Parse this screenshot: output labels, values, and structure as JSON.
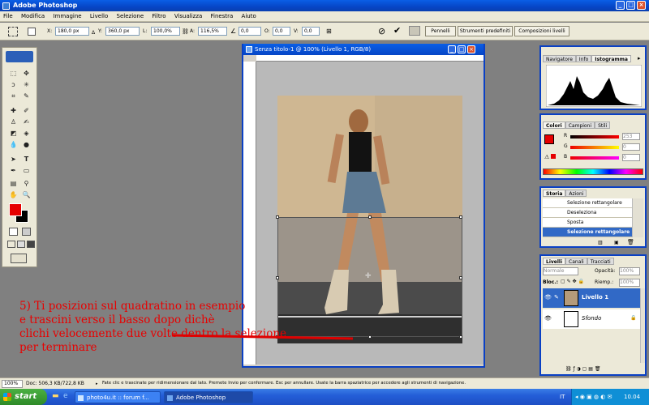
{
  "app": {
    "title": "Adobe Photoshop"
  },
  "menu": [
    "File",
    "Modifica",
    "Immagine",
    "Livello",
    "Selezione",
    "Filtro",
    "Visualizza",
    "Finestra",
    "Aiuto"
  ],
  "options": {
    "x_label": "X:",
    "x_value": "180,0 px",
    "y_label": "Y:",
    "y_value": "360,0 px",
    "w_label": "L:",
    "w_value": "100,0%",
    "h_label": "A:",
    "h_value": "116,5%",
    "angle_value": "0,0",
    "o_label": "O:",
    "o_value": "0,0",
    "v_label": "V:",
    "v_value": "0,0",
    "tabs": [
      "Pennelli",
      "Strumenti predefiniti",
      "Composizioni livelli"
    ]
  },
  "document": {
    "title": "Senza titolo-1 @ 100% (Livello 1, RGB/8)"
  },
  "navigator_panel": {
    "tabs": [
      "Navigatore",
      "Info",
      "Istogramma"
    ],
    "active_tab": "Istogramma"
  },
  "color_panel": {
    "tabs": [
      "Colori",
      "Campioni",
      "Stili"
    ],
    "r_label": "R",
    "g_label": "G",
    "b_label": "B",
    "r_value": "253",
    "g_value": "0",
    "b_value": "0"
  },
  "history_panel": {
    "tabs": [
      "Storia",
      "Azioni"
    ],
    "items": [
      "Selezione rettangolare",
      "Deseleziona",
      "Sposta",
      "Selezione rettangolare"
    ],
    "selected_index": 3
  },
  "layers_panel": {
    "tabs": [
      "Livelli",
      "Canali",
      "Tracciati"
    ],
    "blend_mode": "Normale",
    "opacity_label": "Opacità:",
    "opacity_value": "100%",
    "lock_label": "Bloc.:",
    "fill_label": "Riemp.:",
    "fill_value": "100%",
    "layers": [
      "Livello 1",
      "Sfondo"
    ],
    "selected_index": 0
  },
  "status": {
    "zoom": "100%",
    "doc_info": "Doc: 506,3 KB/722,8 KB",
    "hint": "Fate clic e trascinate per ridimensionare dal lato. Premete Invio per confermare. Esc per annullare. Usate la barra spaziatrice per accedere agli strumenti di navigazione."
  },
  "taskbar": {
    "start_label": "start",
    "tasks": [
      "photo4u.it :: forum f...",
      "Adobe Photoshop"
    ],
    "active_task": 1,
    "lang": "IT",
    "clock": "10.04"
  },
  "caption": "5) Ti posizioni sul quadratino in esempio\ne trascini verso il basso dopo dichè\nclichi velocemente due volte dentro la selezione\nper terminare",
  "colors": {
    "foreground": "#e60000",
    "background": "#000000",
    "caption": "#e80000"
  }
}
